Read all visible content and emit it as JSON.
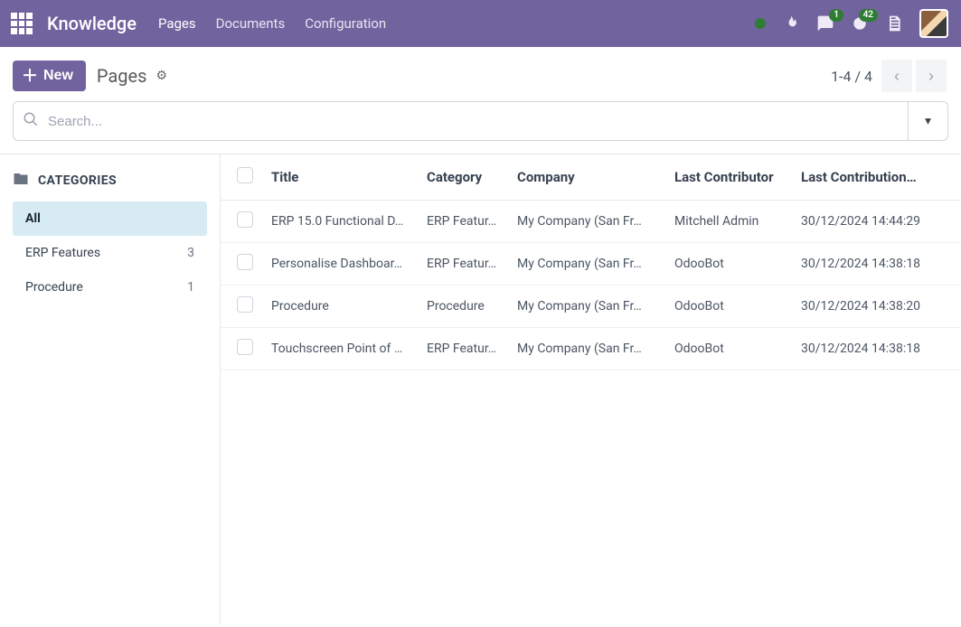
{
  "nav": {
    "brand": "Knowledge",
    "links": [
      "Pages",
      "Documents",
      "Configuration"
    ],
    "active_link": 0,
    "msg_badge": "1",
    "activity_badge": "42"
  },
  "toolbar": {
    "new_label": "New",
    "breadcrumb": "Pages"
  },
  "pager": {
    "text": "1-4 / 4"
  },
  "search": {
    "placeholder": "Search..."
  },
  "sidebar": {
    "header": "CATEGORIES",
    "items": [
      {
        "label": "All",
        "count": "",
        "active": true
      },
      {
        "label": "ERP Features",
        "count": "3",
        "active": false
      },
      {
        "label": "Procedure",
        "count": "1",
        "active": false
      }
    ]
  },
  "table": {
    "headers": [
      "Title",
      "Category",
      "Company",
      "Last Contributor",
      "Last Contribution…"
    ],
    "rows": [
      {
        "title": "ERP 15.0 Functional D…",
        "category": "ERP Featur…",
        "company": "My Company (San Fr…",
        "contributor": "Mitchell Admin",
        "date": "30/12/2024 14:44:29"
      },
      {
        "title": "Personalise Dashboar…",
        "category": "ERP Featur…",
        "company": "My Company (San Fr…",
        "contributor": "OdooBot",
        "date": "30/12/2024 14:38:18"
      },
      {
        "title": "Procedure",
        "category": "Procedure",
        "company": "My Company (San Fr…",
        "contributor": "OdooBot",
        "date": "30/12/2024 14:38:20"
      },
      {
        "title": "Touchscreen Point of …",
        "category": "ERP Featur…",
        "company": "My Company (San Fr…",
        "contributor": "OdooBot",
        "date": "30/12/2024 14:38:18"
      }
    ]
  }
}
